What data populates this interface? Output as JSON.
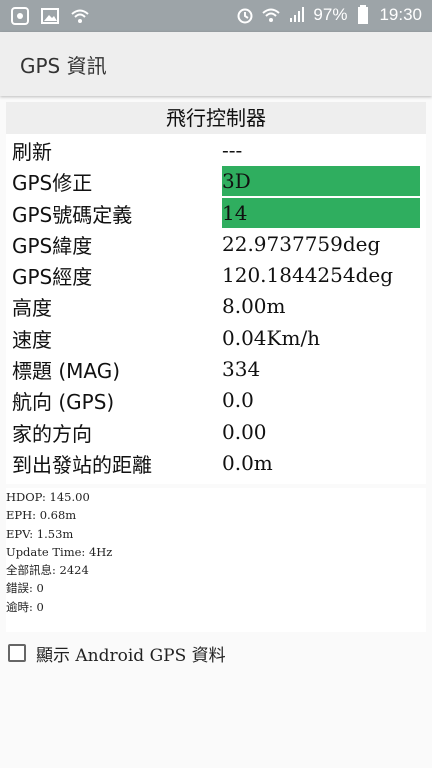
{
  "status_bar": {
    "battery": "97%",
    "time": "19:30"
  },
  "app_bar": {
    "title": "GPS 資訊"
  },
  "panel": {
    "title": "飛行控制器",
    "rows": [
      {
        "label": "刷新",
        "value": "---",
        "highlight": false
      },
      {
        "label": "GPS修正",
        "value": "3D",
        "highlight": true
      },
      {
        "label": "GPS號碼定義",
        "value": "14",
        "highlight": true
      },
      {
        "label": "GPS緯度",
        "value": "22.9737759deg",
        "highlight": false
      },
      {
        "label": "GPS經度",
        "value": "120.1844254deg",
        "highlight": false
      },
      {
        "label": "高度",
        "value": "8.00m",
        "highlight": false
      },
      {
        "label": "速度",
        "value": "0.04Km/h",
        "highlight": false
      },
      {
        "label": "標題 (MAG)",
        "value": "334",
        "highlight": false
      },
      {
        "label": "航向 (GPS)",
        "value": "0.0",
        "highlight": false
      },
      {
        "label": "家的方向",
        "value": "0.00",
        "highlight": false
      },
      {
        "label": "到出發站的距離",
        "value": "0.0m",
        "highlight": false
      }
    ]
  },
  "info_lines": [
    "HDOP: 145.00",
    "EPH: 0.68m",
    "EPV: 1.53m",
    "Update Time: 4Hz",
    "全部訊息: 2424",
    "錯誤: 0",
    "逾時: 0"
  ],
  "checkbox": {
    "label": "顯示 Android GPS 資料",
    "checked": false
  },
  "colors": {
    "highlight": "#2fae5f",
    "status_bar": "#9da4a8"
  }
}
